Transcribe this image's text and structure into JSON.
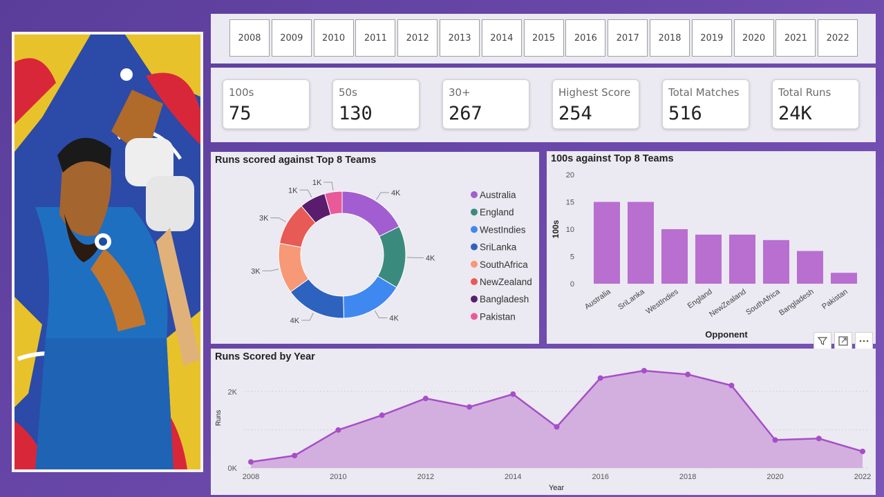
{
  "years": [
    "2008",
    "2009",
    "2010",
    "2011",
    "2012",
    "2013",
    "2014",
    "2015",
    "2016",
    "2017",
    "2018",
    "2019",
    "2020",
    "2021",
    "2022"
  ],
  "kpis": [
    {
      "label": "100s",
      "value": "75"
    },
    {
      "label": "50s",
      "value": "130"
    },
    {
      "label": "30+",
      "value": "267"
    },
    {
      "label": "Highest Score",
      "value": "254"
    },
    {
      "label": "Total Matches",
      "value": "516"
    },
    {
      "label": "Total Runs",
      "value": "24K"
    }
  ],
  "colors": {
    "accent": "#b86fd0",
    "line": "#a64ec7",
    "area": "#cfa4dc",
    "background": "#6a48aa",
    "panel": "#ebe9f1"
  },
  "toolbar_icons": [
    "filter-icon",
    "focus-mode-icon",
    "more-options-icon"
  ],
  "chart_data": [
    {
      "type": "pie",
      "title": "Runs scored against Top 8 Teams",
      "hole": true,
      "legend_position": "right",
      "categories": [
        "Australia",
        "England",
        "WestIndies",
        "SriLanka",
        "SouthAfrica",
        "NewZealand",
        "Bangladesh",
        "Pakistan"
      ],
      "values": [
        4000,
        3600,
        3600,
        3500,
        2900,
        2500,
        1500,
        1000
      ],
      "labels": [
        "4K",
        "4K",
        "4K",
        "4K",
        "3K",
        "3K",
        "1K",
        "1K"
      ],
      "colors": [
        "#a25ed0",
        "#3b8a7e",
        "#3f88f0",
        "#2d63bf",
        "#f79877",
        "#e85a55",
        "#5a1d6e",
        "#e85a9a"
      ]
    },
    {
      "type": "bar",
      "title": "100s against Top 8 Teams",
      "xlabel": "Opponent",
      "ylabel": "100s",
      "ylim": [
        0,
        20
      ],
      "yticks": [
        0,
        5,
        10,
        15,
        20
      ],
      "categories": [
        "Australia",
        "SriLanka",
        "WestIndies",
        "England",
        "NewZealand",
        "SouthAfrica",
        "Bangladesh",
        "Pakistan"
      ],
      "values": [
        15,
        15,
        10,
        9,
        9,
        8,
        6,
        2
      ],
      "color": "#b86fd0"
    },
    {
      "type": "area",
      "title": "Runs Scored by Year",
      "xlabel": "Year",
      "ylabel": "Runs",
      "yticks": [
        "0K",
        "2K"
      ],
      "x": [
        2008,
        2009,
        2010,
        2011,
        2012,
        2013,
        2014,
        2015,
        2016,
        2017,
        2018,
        2019,
        2020,
        2021,
        2022
      ],
      "xticks": [
        "2008",
        "2010",
        "2012",
        "2014",
        "2016",
        "2018",
        "2020",
        "2022"
      ],
      "y": [
        159,
        325,
        995,
        1381,
        1821,
        1597,
        1932,
        1077,
        2354,
        2547,
        2449,
        2159,
        734,
        772,
        434
      ],
      "ylim": [
        0,
        2800
      ],
      "grid": true
    }
  ]
}
